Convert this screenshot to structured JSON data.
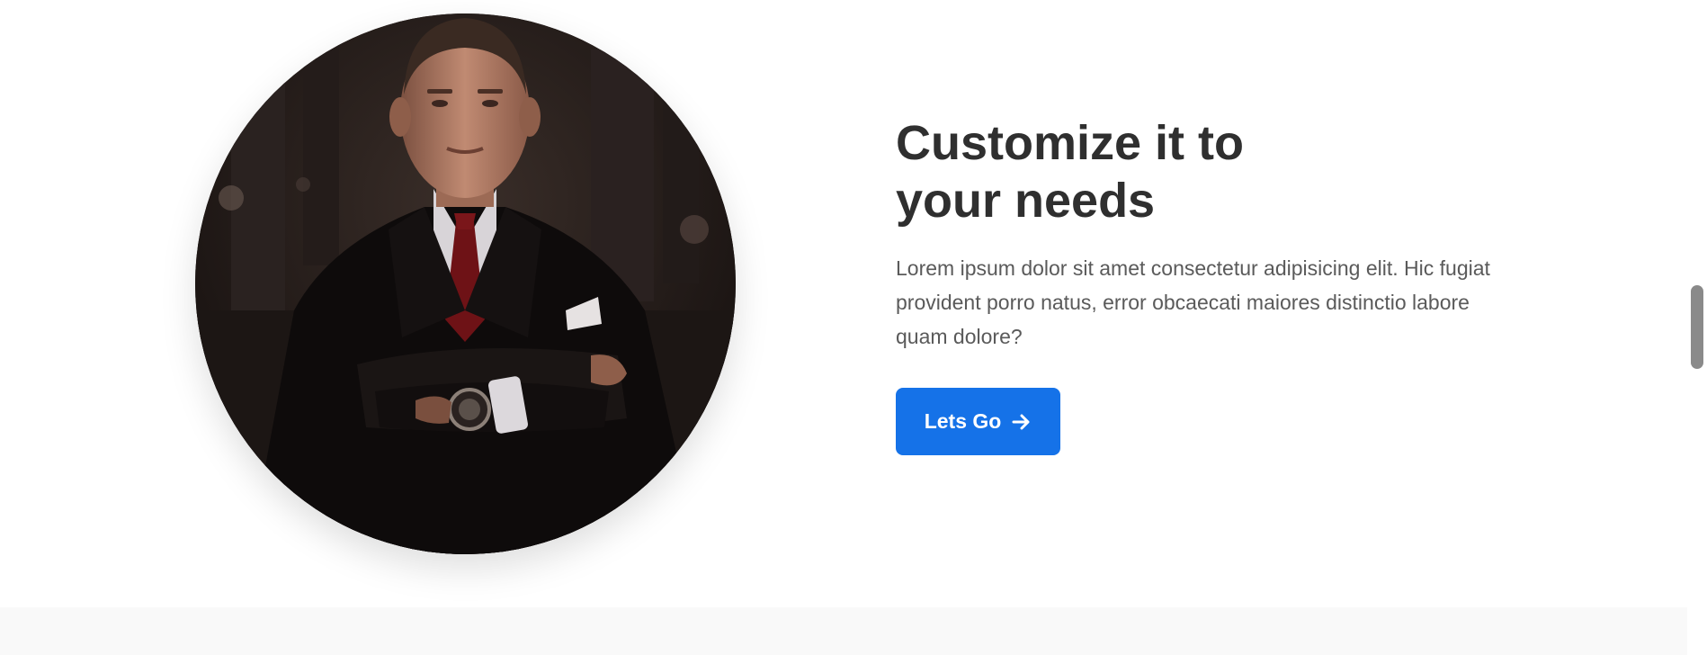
{
  "hero": {
    "headline_line1": "Customize it to",
    "headline_line2": "your needs",
    "body": "Lorem ipsum dolor sit amet consectetur adipisicing elit. Hic fugiat provident porro natus, error obcaecati maiores distinctio labore quam dolore?",
    "cta_label": "Lets Go",
    "cta_icon": "arrow-right-icon",
    "portrait_alt": "man in suit with crossed arms"
  },
  "colors": {
    "heading": "#2f2f2f",
    "body": "#5a5a5a",
    "underline_accent": "#f6c33f",
    "button": "#1572e8",
    "section_bg": "#ffffff",
    "next_section_bg": "#f9f9f9"
  }
}
